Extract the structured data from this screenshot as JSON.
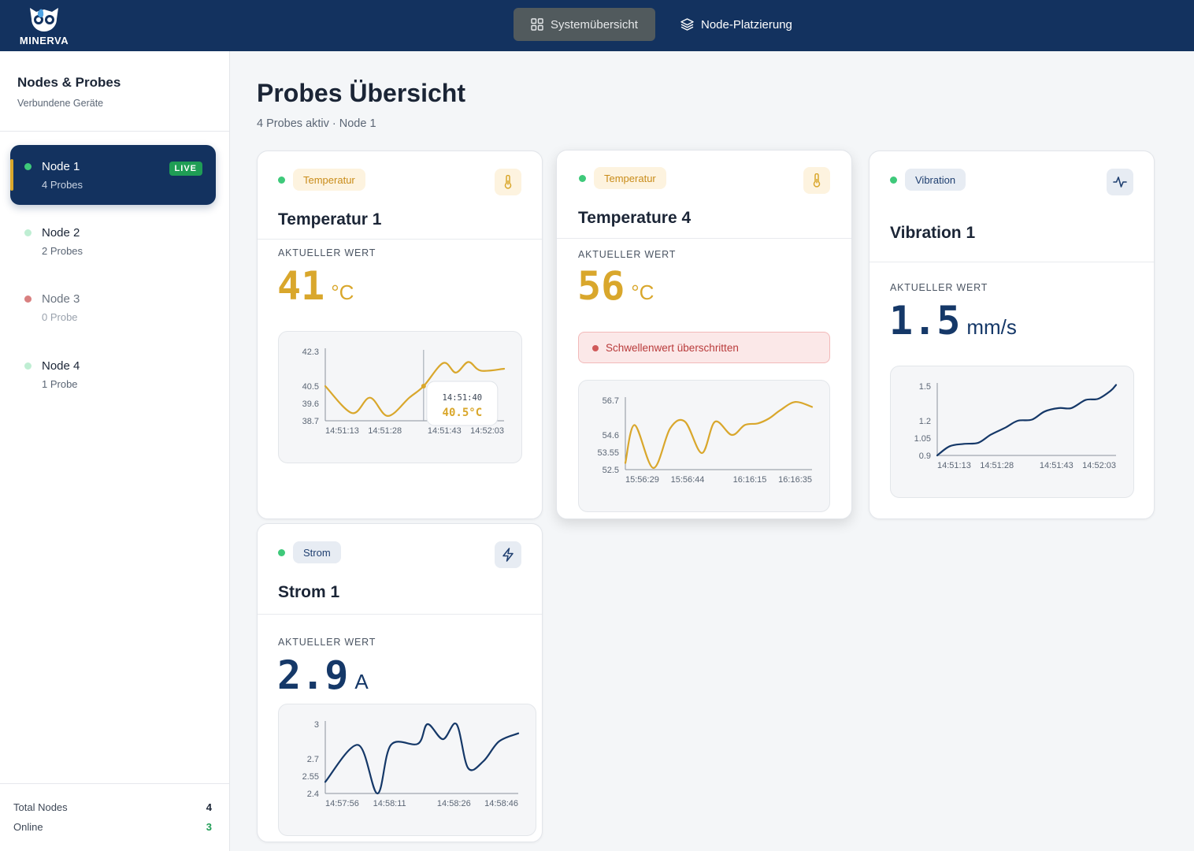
{
  "brand": {
    "name": "MINERVA"
  },
  "nav": {
    "tabs": [
      {
        "label": "Systemübersicht",
        "icon": "grid-icon",
        "active": true
      },
      {
        "label": "Node-Platzierung",
        "icon": "layers-icon",
        "active": false
      }
    ]
  },
  "sidebar": {
    "title": "Nodes & Probes",
    "subtitle": "Verbundene Geräte",
    "nodes": [
      {
        "name": "Node 1",
        "probes": "4 Probes",
        "status": "live",
        "badge": "LIVE",
        "dot_color": "#3ec97a"
      },
      {
        "name": "Node 2",
        "probes": "2 Probes",
        "status": "online",
        "dot_color": "#bfeed3"
      },
      {
        "name": "Node 3",
        "probes": "0 Probe",
        "status": "offline",
        "dot_color": "#d98080"
      },
      {
        "name": "Node 4",
        "probes": "1 Probe",
        "status": "online",
        "dot_color": "#bfeed3"
      }
    ],
    "footer": {
      "total_label": "Total Nodes",
      "total_value": "4",
      "online_label": "Online",
      "online_value": "3"
    }
  },
  "main": {
    "title": "Probes Übersicht",
    "subtitle": "4 Probes aktiv  · Node 1",
    "current_label": "AKTUELLER WERT"
  },
  "colors": {
    "amber": "#d9a72c",
    "navy": "#153868",
    "green": "#3ec97a",
    "alert": "#b93b3b"
  },
  "cards": [
    {
      "chip": "Temperatur",
      "icon": "thermometer-icon",
      "title": "Temperatur 1",
      "value": "41",
      "unit": "°C",
      "tooltip": {
        "time": "14:51:40",
        "value": "40.5°C"
      }
    },
    {
      "chip": "Temperatur",
      "icon": "thermometer-icon",
      "title": "Temperature 4",
      "value": "56",
      "unit": "°C",
      "alert": "Schwellenwert überschritten"
    },
    {
      "chip": "Vibration",
      "icon": "activity-icon",
      "title": "Vibration 1",
      "value": "1.5",
      "unit": "mm/s"
    },
    {
      "chip": "Strom",
      "icon": "lightning-icon",
      "title": "Strom 1",
      "value": "2.9",
      "unit": "A"
    }
  ],
  "chart_data": [
    {
      "type": "line",
      "title": "",
      "xlabel": "",
      "ylabel": "",
      "yticks": [
        "42.3",
        "40.5",
        "39.6",
        "38.7"
      ],
      "ytick_values": [
        42.3,
        40.5,
        39.6,
        38.7
      ],
      "ylim": [
        38.7,
        42.3
      ],
      "xticks": [
        "14:51:13",
        "14:51:28",
        "14:51:43",
        "14:52:03"
      ],
      "xlim": [
        0,
        10
      ],
      "x": [
        0,
        1.5,
        2.5,
        3.5,
        4.7,
        5.5,
        6.6,
        7.3,
        8.0,
        8.7,
        10
      ],
      "y": [
        40.5,
        39.1,
        39.9,
        38.95,
        39.9,
        40.5,
        41.7,
        41.2,
        41.75,
        41.3,
        41.4
      ],
      "series": [
        {
          "values": [
            40.5,
            39.1,
            39.9,
            38.95,
            39.9,
            40.5,
            41.7,
            41.2,
            41.75,
            41.3,
            41.4
          ]
        }
      ],
      "tooltip_index": 5,
      "color": "#d9a72c"
    },
    {
      "type": "line",
      "title": "",
      "xlabel": "",
      "ylabel": "",
      "yticks": [
        "56.7",
        "54.6",
        "53.55",
        "52.5"
      ],
      "ytick_values": [
        56.7,
        54.6,
        53.55,
        52.5
      ],
      "ylim": [
        52.5,
        56.7
      ],
      "xticks": [
        "15:56:29",
        "15:56:44",
        "16:16:15",
        "16:16:35"
      ],
      "xlim": [
        0,
        10
      ],
      "x": [
        0,
        0.5,
        1.5,
        2.4,
        3.2,
        4.1,
        4.8,
        5.7,
        6.4,
        7.1,
        7.7,
        8.3,
        9.1,
        10
      ],
      "y": [
        52.9,
        55.2,
        52.6,
        55.0,
        55.4,
        53.5,
        55.4,
        54.6,
        55.2,
        55.3,
        55.6,
        56.1,
        56.6,
        56.3
      ],
      "color": "#d9a72c"
    },
    {
      "type": "line",
      "title": "",
      "xlabel": "",
      "ylabel": "",
      "yticks": [
        "1.5",
        "1.2",
        "1.05",
        "0.9"
      ],
      "ytick_values": [
        1.5,
        1.2,
        1.05,
        0.9
      ],
      "ylim": [
        0.9,
        1.5
      ],
      "xticks": [
        "14:51:13",
        "14:51:28",
        "14:51:43",
        "14:52:03"
      ],
      "xlim": [
        0,
        10
      ],
      "x": [
        0,
        0.7,
        1.5,
        2.3,
        3.0,
        3.8,
        4.5,
        5.3,
        6.0,
        6.8,
        7.5,
        8.3,
        9.0,
        9.7,
        10
      ],
      "y": [
        0.9,
        0.98,
        1.0,
        1.01,
        1.08,
        1.14,
        1.2,
        1.21,
        1.28,
        1.31,
        1.31,
        1.38,
        1.39,
        1.46,
        1.51
      ],
      "color": "#153868"
    },
    {
      "type": "line",
      "title": "",
      "xlabel": "",
      "ylabel": "",
      "yticks": [
        "3",
        "2.7",
        "2.55",
        "2.4"
      ],
      "ytick_values": [
        3.0,
        2.7,
        2.55,
        2.4
      ],
      "ylim": [
        2.4,
        3.0
      ],
      "xticks": [
        "14:57:56",
        "14:58:11",
        "14:58:26",
        "14:58:46"
      ],
      "xlim": [
        0,
        10
      ],
      "x": [
        0,
        1.7,
        2.7,
        3.4,
        4.8,
        5.3,
        6.1,
        6.8,
        7.4,
        8.2,
        9.0,
        10
      ],
      "y": [
        2.5,
        2.82,
        2.4,
        2.82,
        2.83,
        3.0,
        2.87,
        3.0,
        2.62,
        2.68,
        2.85,
        2.92
      ],
      "color": "#153868"
    }
  ]
}
